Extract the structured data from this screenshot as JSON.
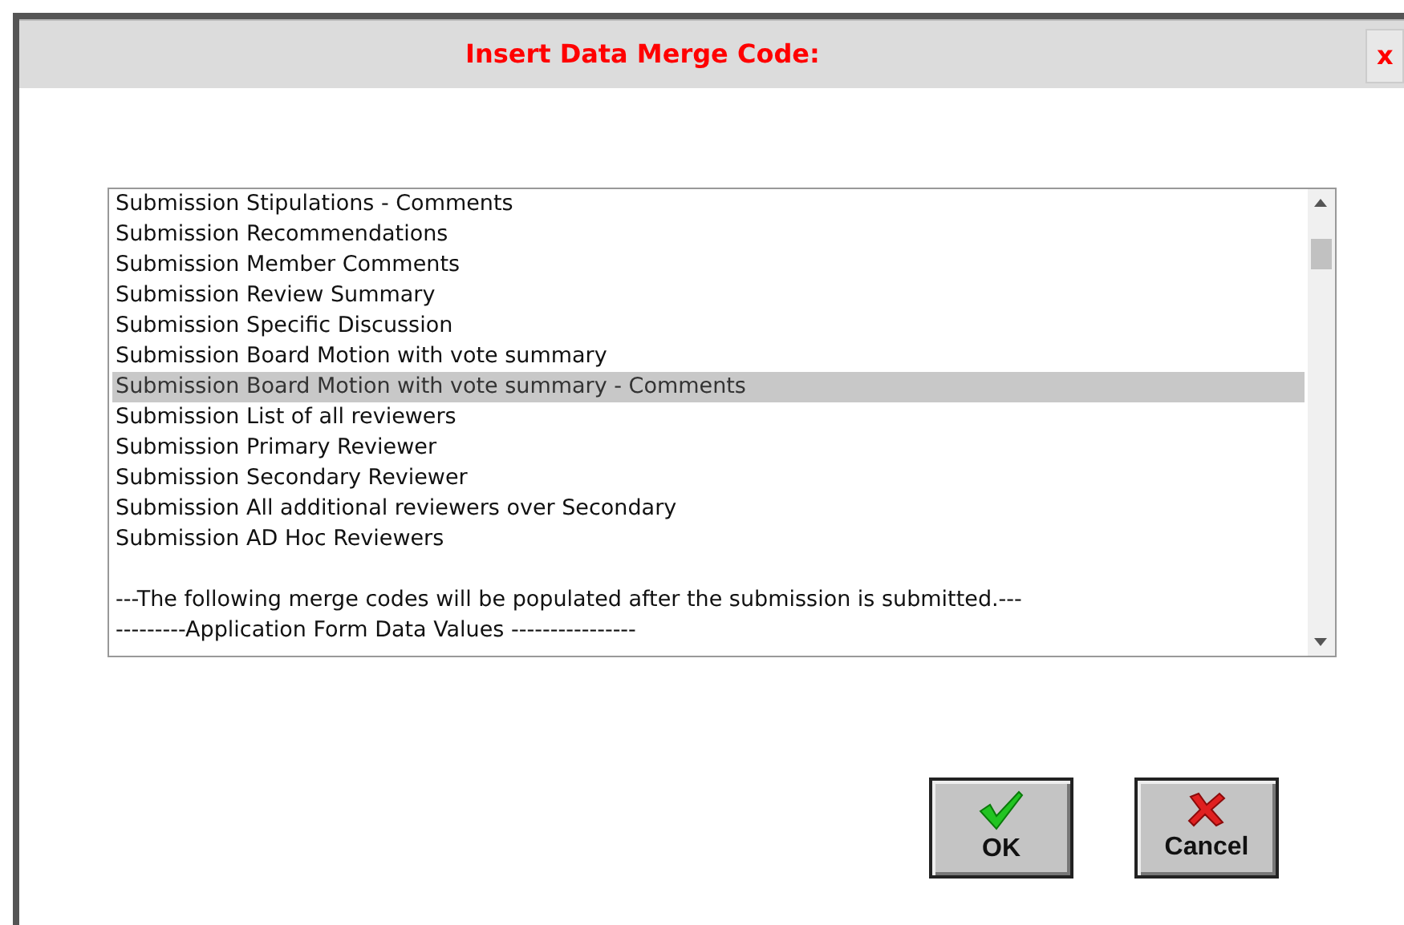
{
  "dialog": {
    "title": "Insert Data Merge Code:",
    "close": "x"
  },
  "list": {
    "items": [
      {
        "text": "Submission Stipulations - Comments",
        "selected": false
      },
      {
        "text": "Submission Recommendations",
        "selected": false
      },
      {
        "text": "Submission Member Comments",
        "selected": false
      },
      {
        "text": "Submission Review Summary",
        "selected": false
      },
      {
        "text": "Submission Specific Discussion",
        "selected": false
      },
      {
        "text": "Submission Board Motion with vote summary",
        "selected": false
      },
      {
        "text": "Submission Board Motion with vote summary - Comments",
        "selected": true
      },
      {
        "text": "Submission List of all reviewers",
        "selected": false
      },
      {
        "text": "Submission Primary Reviewer",
        "selected": false
      },
      {
        "text": "Submission Secondary Reviewer",
        "selected": false
      },
      {
        "text": "Submission All additional reviewers over Secondary",
        "selected": false
      },
      {
        "text": "Submission AD Hoc Reviewers",
        "selected": false
      },
      {
        "text": "---The following merge codes will be populated after the submission is submitted.---",
        "selected": false,
        "spaced": true
      },
      {
        "text": "---------Application Form Data Values ----------------",
        "selected": false
      }
    ]
  },
  "buttons": [
    {
      "kind": "ok",
      "label": "OK"
    },
    {
      "kind": "cancel",
      "label": "Cancel"
    }
  ]
}
